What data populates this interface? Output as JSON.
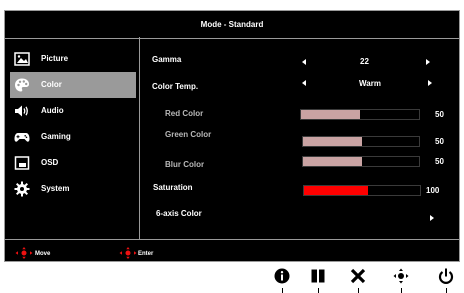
{
  "osd": {
    "title": "Mode - Standard",
    "menu": [
      {
        "label": "Picture",
        "icon": "picture-icon",
        "active": false
      },
      {
        "label": "Color",
        "icon": "palette-icon",
        "active": true
      },
      {
        "label": "Audio",
        "icon": "speaker-icon",
        "active": false
      },
      {
        "label": "Gaming",
        "icon": "gamepad-icon",
        "active": false
      },
      {
        "label": "OSD",
        "icon": "osd-window-icon",
        "active": false
      },
      {
        "label": "System",
        "icon": "gear-icon",
        "active": false
      }
    ],
    "settings": {
      "gamma": {
        "label": "Gamma",
        "value": "22"
      },
      "color_temp": {
        "label": "Color Temp.",
        "value": "Warm"
      },
      "red": {
        "label": "Red Color",
        "value": "50",
        "level": 0.5
      },
      "green": {
        "label": "Green Color",
        "value": "50",
        "level": 0.5
      },
      "blue": {
        "label": "Blur Color",
        "value": "50",
        "level": 0.5
      },
      "saturation": {
        "label": "Saturation",
        "value": "100",
        "level": 0.55
      },
      "six_axis": {
        "label": "6-axis Color"
      }
    },
    "hints": {
      "move": "Move",
      "enter": "Enter"
    },
    "colors": {
      "slider_fill": "#c9a3a3",
      "saturation_fill": "#ff0000",
      "active_bg": "#9a9a9a"
    }
  },
  "buttons": [
    "info-icon",
    "pause-icon",
    "close-icon",
    "navigate-icon",
    "power-icon"
  ]
}
